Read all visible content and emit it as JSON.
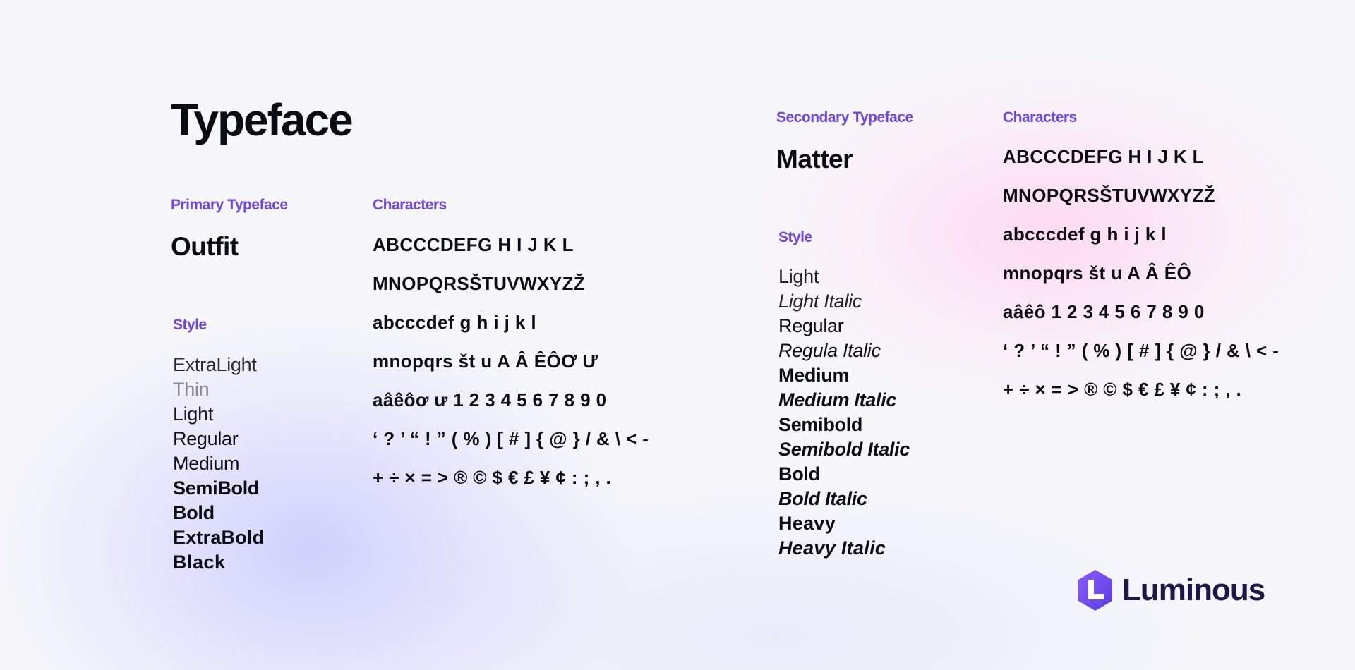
{
  "page": {
    "title": "Typeface"
  },
  "primary": {
    "label": "Primary Typeface",
    "name": "Outfit",
    "style_label": "Style",
    "styles": [
      "ExtraLight",
      "Thin",
      "Light",
      "Regular",
      "Medium",
      "SemiBold",
      "Bold",
      "ExtraBold",
      "Black"
    ],
    "characters_label": "Characters",
    "characters": [
      "ABCCCDEFG H I J K L",
      "MNOPQRSŠTUVWXYZŽ",
      "abcccdef g h i j k l",
      "mnopqrs št u A Â ÊÔƠ Ư",
      "aâêôơ ư 1 2 3 4 5 6 7 8 9 0",
      "‘ ? ’ “ ! ” ( % ) [ # ] { @ } / & \\ < -",
      "+ ÷ × = > ® © $ € £ ¥ ¢ : ; , ."
    ]
  },
  "secondary": {
    "label": "Secondary Typeface",
    "name": "Matter",
    "style_label": "Style",
    "styles": [
      "Light",
      "Light Italic",
      "Regular",
      "Regula Italic",
      "Medium",
      "Medium Italic",
      "Semibold",
      "Semibold Italic",
      "Bold",
      "Bold Italic",
      "Heavy",
      "Heavy Italic"
    ],
    "characters_label": "Characters",
    "characters": [
      "ABCCCDEFG H I J K L",
      "MNOPQRSŠTUVWXYZŽ",
      "abcccdef g h i j k l",
      "mnopqrs št u A Â ÊÔ",
      "aâêô 1 2 3 4 5 6 7 8 9 0",
      "‘ ? ’ “ ! ” ( % ) [ # ] { @ } / & \\ < -",
      "+ ÷ × = > ® © $ € £ ¥ ¢ : ; , ."
    ]
  },
  "brand": {
    "logo_text": "Luminous",
    "logo_icon": "luminous-hexagon-icon",
    "accent_color": "#6b46e8",
    "logo_color": "#1d1646"
  }
}
